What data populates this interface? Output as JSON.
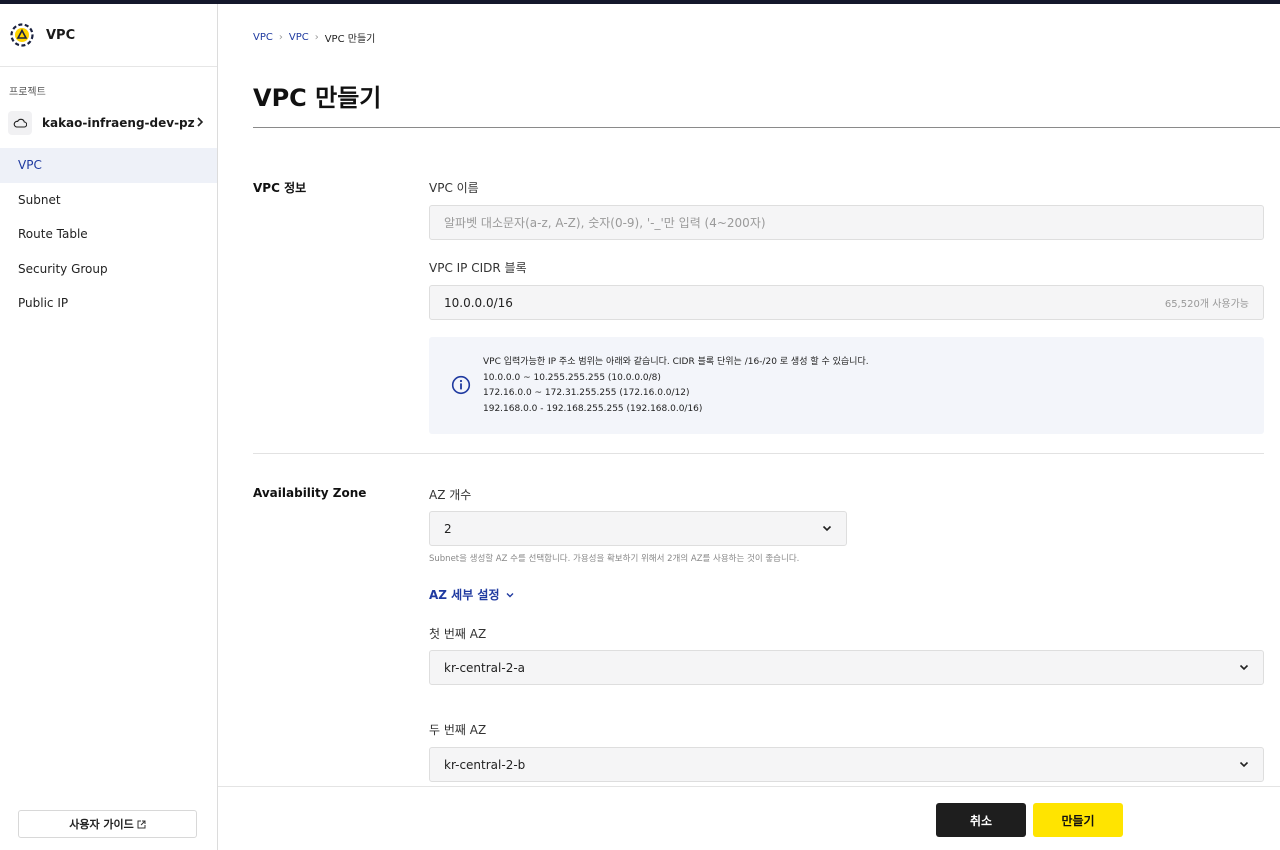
{
  "app": {
    "title": "VPC"
  },
  "sidebar": {
    "project_label": "프로젝트",
    "project_name": "kakao-infraeng-dev-pz",
    "items": [
      {
        "label": "VPC",
        "active": true
      },
      {
        "label": "Subnet"
      },
      {
        "label": "Route Table"
      },
      {
        "label": "Security Group"
      },
      {
        "label": "Public IP"
      }
    ],
    "guide_button": "사용자 가이드"
  },
  "breadcrumb": [
    "VPC",
    "VPC",
    "VPC 만들기"
  ],
  "page_title": "VPC 만들기",
  "vpc_info": {
    "section_title": "VPC 정보",
    "name_label": "VPC 이름",
    "name_placeholder": "알파벳 대소문자(a-z, A-Z), 숫자(0-9), '-_'만 입력 (4~200자)",
    "cidr_label": "VPC IP CIDR 블록",
    "cidr_value": "10.0.0.0/16",
    "cidr_available": "65,520개 사용가능",
    "info_lines": [
      "VPC 입력가능한 IP 주소 범위는 아래와 같습니다. CIDR 블록 단위는 /16-/20 로 생성 할 수 있습니다.",
      "10.0.0.0 ~ 10.255.255.255 (10.0.0.0/8)",
      "172.16.0.0 ~ 172.31.255.255 (172.16.0.0/12)",
      "192.168.0.0 - 192.168.255.255 (192.168.0.0/16)"
    ]
  },
  "availability_zone": {
    "section_title": "Availability Zone",
    "count_label": "AZ 개수",
    "count_value": "2",
    "help_text": "Subnet을 생성할 AZ 수를 선택합니다. 가용성을 확보하기 위해서 2개의 AZ를 사용하는 것이 좋습니다.",
    "detail_toggle": "AZ 세부 설정",
    "first_label": "첫 번째 AZ",
    "first_value": "kr-central-2-a",
    "second_label": "두 번째 AZ",
    "second_value": "kr-central-2-b"
  },
  "footer": {
    "cancel": "취소",
    "create": "만들기"
  },
  "colors": {
    "accent": "#1f3aa0",
    "create_button": "#ffe400",
    "cancel_button": "#1e1e1e"
  }
}
